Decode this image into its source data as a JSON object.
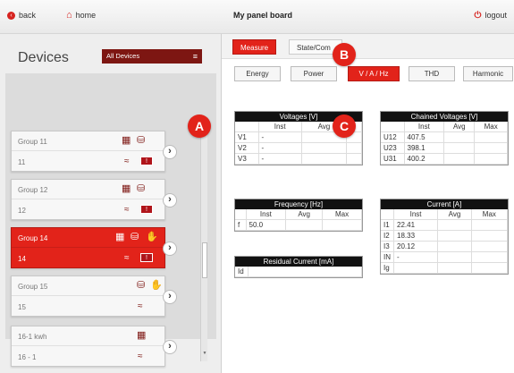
{
  "topbar": {
    "back_label": "back",
    "home_label": "home",
    "title": "My panel board",
    "logout_label": "logout"
  },
  "tabs": {
    "measure": "Measure",
    "state": "State/Com"
  },
  "devices": {
    "title": "Devices",
    "filter": "All Devices",
    "cards": [
      {
        "name": "Group 11",
        "id": "11"
      },
      {
        "name": "Group 12",
        "id": "12"
      },
      {
        "name": "Group 14",
        "id": "14"
      },
      {
        "name": "Group 15",
        "id": "15"
      },
      {
        "name": "16-1 kwh",
        "id": "16 - 1"
      }
    ]
  },
  "measure_tabs": [
    "Energy",
    "Power",
    "V / A / Hz",
    "THD",
    "Harmonic"
  ],
  "voltages": {
    "title": "Voltages [V]",
    "headers": [
      "",
      "Inst",
      "Avg",
      ""
    ],
    "rows": [
      [
        "V1",
        "-",
        "",
        ""
      ],
      [
        "V2",
        "-",
        "",
        ""
      ],
      [
        "V3",
        "-",
        "",
        ""
      ]
    ]
  },
  "chained": {
    "title": "Chained Voltages [V]",
    "headers": [
      "",
      "Inst",
      "Avg",
      "Max"
    ],
    "rows": [
      [
        "U12",
        "407.5",
        "",
        ""
      ],
      [
        "U23",
        "398.1",
        "",
        ""
      ],
      [
        "U31",
        "400.2",
        "",
        ""
      ]
    ]
  },
  "frequency": {
    "title": "Frequency [Hz]",
    "headers": [
      "",
      "Inst",
      "Avg",
      "Max"
    ],
    "rows": [
      [
        "f",
        "50.0",
        "",
        ""
      ]
    ]
  },
  "residual": {
    "title": "Residual Current [mA]",
    "rows": [
      [
        "Id",
        ""
      ]
    ]
  },
  "current": {
    "title": "Current [A]",
    "headers": [
      "",
      "Inst",
      "Avg",
      "Max"
    ],
    "rows": [
      [
        "I1",
        "22.41",
        "",
        ""
      ],
      [
        "I2",
        "18.33",
        "",
        ""
      ],
      [
        "I3",
        "20.12",
        "",
        ""
      ],
      [
        "IN",
        "-",
        "",
        ""
      ],
      [
        "Ig",
        "",
        "",
        ""
      ]
    ]
  },
  "badges": {
    "a": "A",
    "b": "B",
    "c": "C"
  },
  "colors": {
    "accent": "#e2231a",
    "dark_accent": "#7d1612",
    "header": "#111111"
  }
}
